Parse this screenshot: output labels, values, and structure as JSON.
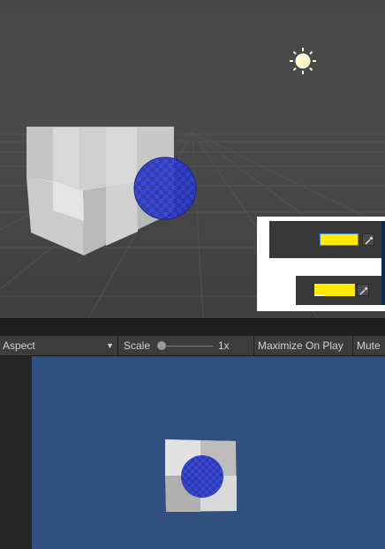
{
  "game_toolbar": {
    "aspect_label": "Aspect",
    "scale_label": "Scale",
    "scale_value": "1x",
    "maximize_label": "Maximize On Play",
    "mute_label": "Mute"
  },
  "colors": {
    "scene_bg": "#484848",
    "game_bg": "#30507f",
    "swatch": "#ffea00",
    "sphere": "#2f3ccf"
  },
  "icons": [
    "sun-icon",
    "eyedropper-icon",
    "dropdown-arrow-icon"
  ]
}
